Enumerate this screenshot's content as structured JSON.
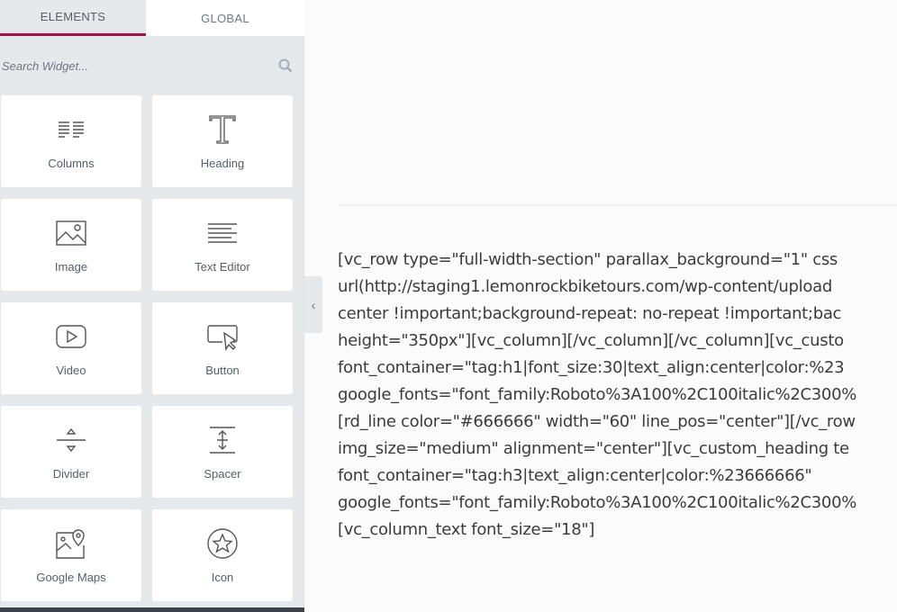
{
  "sidebar": {
    "tabs": [
      {
        "label": "ELEMENTS",
        "active": true
      },
      {
        "label": "GLOBAL",
        "active": false
      }
    ],
    "search_placeholder": "Search Widget...",
    "accent_color": "#a3154a",
    "widgets": [
      {
        "label": "Columns",
        "icon": "columns-icon"
      },
      {
        "label": "Heading",
        "icon": "heading-icon"
      },
      {
        "label": "Image",
        "icon": "image-icon"
      },
      {
        "label": "Text Editor",
        "icon": "text-editor-icon"
      },
      {
        "label": "Video",
        "icon": "video-icon"
      },
      {
        "label": "Button",
        "icon": "button-icon"
      },
      {
        "label": "Divider",
        "icon": "divider-icon"
      },
      {
        "label": "Spacer",
        "icon": "spacer-icon"
      },
      {
        "label": "Google Maps",
        "icon": "google-maps-icon"
      },
      {
        "label": "Icon",
        "icon": "star-icon"
      }
    ]
  },
  "canvas": {
    "code_lines": [
      "[vc_row type=\"full-width-section\" parallax_background=\"1\" css",
      "url(http://staging1.lemonrockbiketours.com/wp-content/upload",
      "center !important;background-repeat: no-repeat !important;bac",
      "height=\"350px\"][vc_column][/vc_column][/vc_column][vc_custo",
      "font_container=\"tag:h1|font_size:30|text_align:center|color:%23",
      "google_fonts=\"font_family:Roboto%3A100%2C100italic%2C300%",
      "[rd_line color=\"#666666\" width=\"60\" line_pos=\"center\"][/vc_row",
      "img_size=\"medium\" alignment=\"center\"][vc_custom_heading te",
      "font_container=\"tag:h3|text_align:center|color:%23666666\"",
      "google_fonts=\"font_family:Roboto%3A100%2C100italic%2C300%",
      "[vc_column_text font_size=\"18\"]"
    ]
  }
}
